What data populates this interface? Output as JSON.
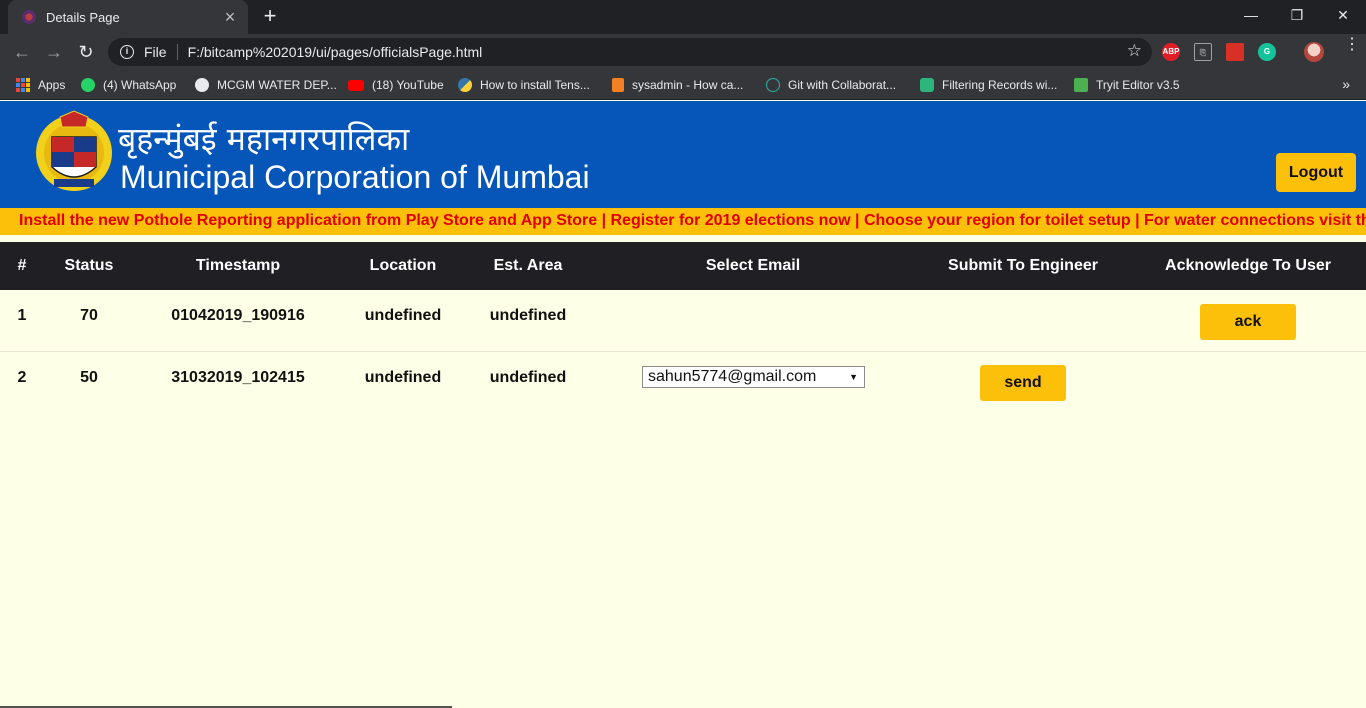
{
  "browser": {
    "tab_title": "Details Page",
    "file_label": "File",
    "url": "F:/bitcamp%202019/ui/pages/officialsPage.html",
    "bookmarks": [
      {
        "label": "Apps",
        "icon": "apps-grid-icon"
      },
      {
        "label": "(4) WhatsApp",
        "icon": "whatsapp-icon",
        "color": "#25d366"
      },
      {
        "label": "MCGM WATER DEP...",
        "icon": "globe-icon",
        "color": "#e8eaed"
      },
      {
        "label": "(18) YouTube",
        "icon": "youtube-icon",
        "color": "#ff0000"
      },
      {
        "label": "How to install Tens...",
        "icon": "python-icon",
        "color": "#3776ab"
      },
      {
        "label": "sysadmin - How ca...",
        "icon": "stackoverflow-icon",
        "color": "#f48024"
      },
      {
        "label": "Git with Collaborat...",
        "icon": "git-icon",
        "color": "#2bb3a3"
      },
      {
        "label": "Filtering Records wi...",
        "icon": "mongodb-icon",
        "color": "#2cb67d"
      },
      {
        "label": "Tryit Editor v3.5",
        "icon": "w3schools-icon",
        "color": "#4caf50"
      }
    ],
    "extensions": [
      {
        "label": "ABP",
        "icon": "adblock-icon",
        "color": "#e01e25"
      },
      {
        "label": "",
        "icon": "pdf-icon",
        "color": "#9aa0a6"
      },
      {
        "label": "",
        "icon": "bookmark-ext-icon",
        "color": "#d93025"
      },
      {
        "label": "G",
        "icon": "grammarly-icon",
        "color": "#15c39a"
      }
    ]
  },
  "header": {
    "title_hindi": "बृहन्मुंबई महानगरपालिका",
    "title_english": "Municipal Corporation of Mumbai",
    "logout_label": "Logout"
  },
  "marquee_text": "Install the new Pothole Reporting application from Play Store and App Store | Register for 2019 elections now | Choose your region for toilet setup | For water connections visit the official MCGM",
  "table": {
    "headers": [
      "#",
      "Status",
      "Timestamp",
      "Location",
      "Est. Area",
      "Select Email",
      "Submit To Engineer",
      "Acknowledge To User"
    ],
    "rows": [
      {
        "num": "1",
        "status": "70",
        "timestamp": "01042019_190916",
        "location": "undefined",
        "area": "undefined",
        "email": "",
        "submit": "",
        "ack": "ack"
      },
      {
        "num": "2",
        "status": "50",
        "timestamp": "31032019_102415",
        "location": "undefined",
        "area": "undefined",
        "email": "sahun5774@gmail.com",
        "submit": "send",
        "ack": ""
      }
    ]
  },
  "colors": {
    "header_blue": "#0655b8",
    "accent_yellow": "#fcc00a",
    "marquee_red": "#e00000",
    "table_head": "#1f1f24",
    "page_bg": "#fdffe6"
  }
}
